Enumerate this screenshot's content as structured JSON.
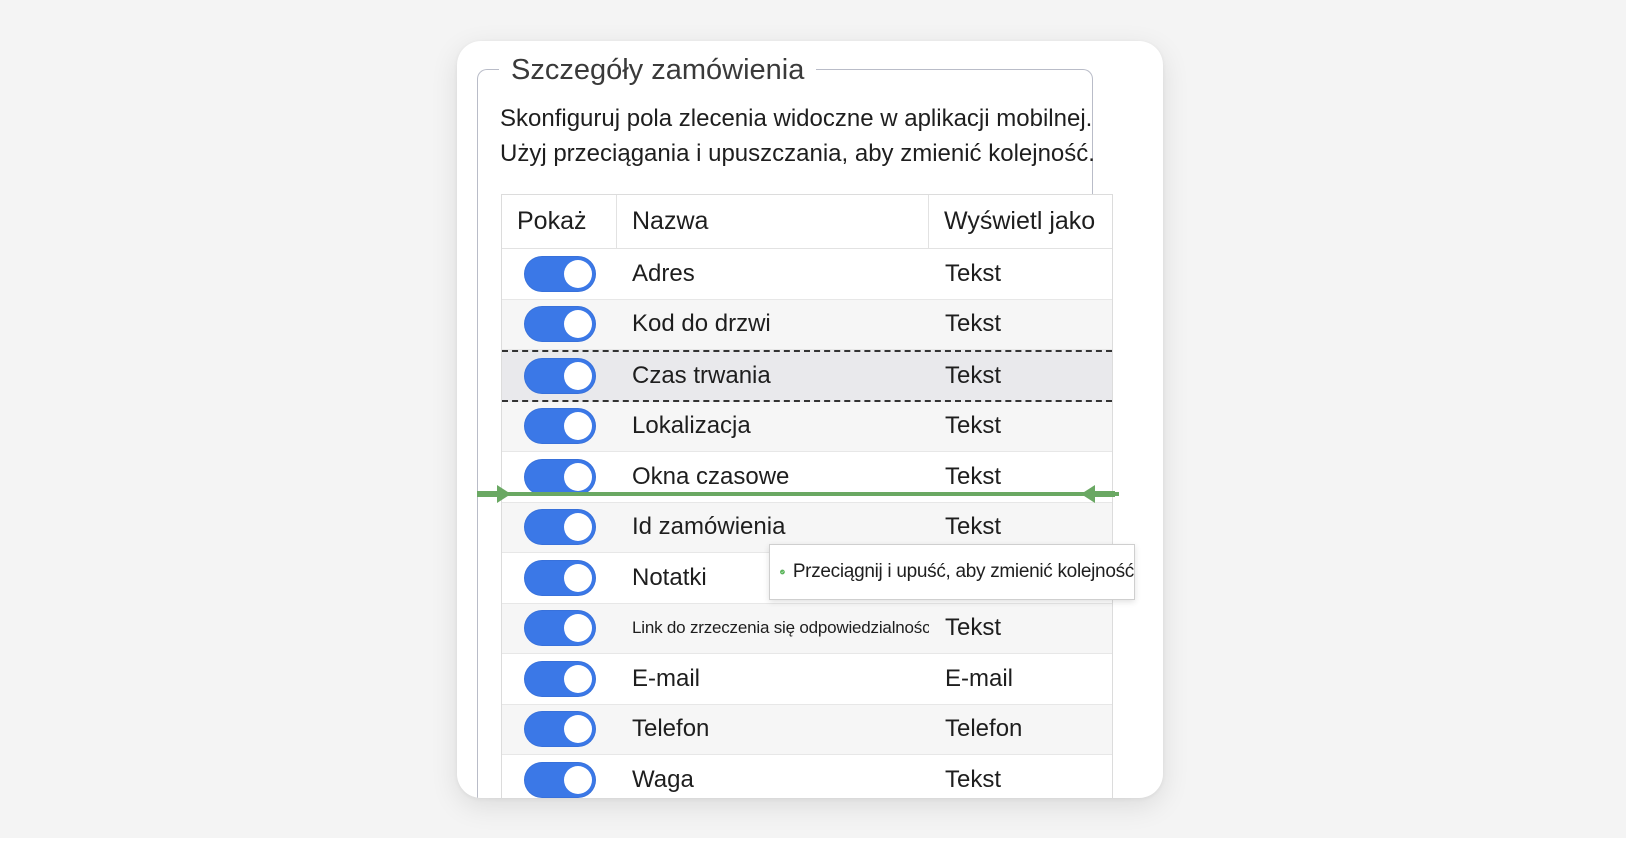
{
  "panel": {
    "legend": "Szczegóły zamówienia",
    "description_line1": "Skonfiguruj pola zlecenia widoczne w aplikacji mobilnej.",
    "description_line2": "Użyj przeciągania i upuszczania, aby zmienić kolejność."
  },
  "table": {
    "headers": {
      "show": "Pokaż",
      "name": "Nazwa",
      "display_as": "Wyświetl jako"
    },
    "rows": [
      {
        "name": "Adres",
        "display": "Tekst",
        "enabled": true
      },
      {
        "name": "Kod do drzwi",
        "display": "Tekst",
        "enabled": true
      },
      {
        "name": "Czas trwania",
        "display": "Tekst",
        "enabled": true
      },
      {
        "name": "Lokalizacja",
        "display": "Tekst",
        "enabled": true
      },
      {
        "name": "Okna czasowe",
        "display": "Tekst",
        "enabled": true
      },
      {
        "name": "Id zamówienia",
        "display": "Tekst",
        "enabled": true
      },
      {
        "name": "Notatki",
        "display": "",
        "enabled": true
      },
      {
        "name": "Link do zrzeczenia się odpowiedzialności",
        "display": "Tekst",
        "enabled": true
      },
      {
        "name": "E-mail",
        "display": "E-mail",
        "enabled": true
      },
      {
        "name": "Telefon",
        "display": "Telefon",
        "enabled": true
      },
      {
        "name": "Waga",
        "display": "Tekst",
        "enabled": true
      }
    ]
  },
  "tooltip": {
    "text": "Przeciągnij i upuść, aby zmienić kolejność",
    "icon": "check-circle-icon"
  },
  "colors": {
    "toggle_on": "#3b78e7",
    "drop_indicator": "#6aa863",
    "tooltip_icon": "#5cb85c"
  }
}
